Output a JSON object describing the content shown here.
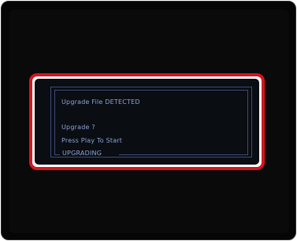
{
  "dialog": {
    "line1": "Upgrade File DETECTED",
    "line2": "Upgrade ?",
    "line3": "Press Play To Start",
    "status": "UPGRADING"
  },
  "colors": {
    "highlight_border": "#d4161f",
    "text": "#8da3d6",
    "frame_line": "#3d4c7a",
    "screen_bg": "#050505"
  }
}
